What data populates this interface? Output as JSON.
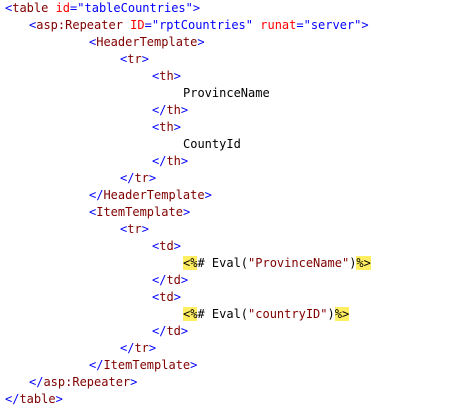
{
  "editor": {
    "colors": {
      "background": "#ffffff",
      "delimiter": "#0000ff",
      "tag_name": "#800000",
      "attribute_name": "#ff0000",
      "attribute_value": "#0000ff",
      "text": "#000000",
      "server_block_highlight": "#ffee62"
    },
    "lines": [
      {
        "open": "<",
        "tag": "table",
        "attr1": " id",
        "eq1": "=",
        "val1": "\"tableCountries\"",
        "close": ">"
      },
      {
        "open": "<",
        "tag": "asp:Repeater",
        "attr1": " ID",
        "eq1": "=",
        "val1": "\"rptCountries\"",
        "attr2": " runat",
        "eq2": "=",
        "val2": "\"server\"",
        "close": ">"
      },
      {
        "open": "<",
        "tag": "HeaderTemplate",
        "close": ">"
      },
      {
        "open": "<",
        "tag": "tr",
        "close": ">"
      },
      {
        "open": "<",
        "tag": "th",
        "close": ">"
      },
      {
        "text": "ProvinceName"
      },
      {
        "open": "</",
        "tag": "th",
        "close": ">"
      },
      {
        "open": "<",
        "tag": "th",
        "close": ">"
      },
      {
        "text": "CountyId"
      },
      {
        "open": "</",
        "tag": "th",
        "close": ">"
      },
      {
        "open": "</",
        "tag": "tr",
        "close": ">"
      },
      {
        "open": "</",
        "tag": "HeaderTemplate",
        "close": ">"
      },
      {
        "open": "<",
        "tag": "ItemTemplate",
        "close": ">"
      },
      {
        "open": "<",
        "tag": "tr",
        "close": ">"
      },
      {
        "open": "<",
        "tag": "td",
        "close": ">"
      },
      {
        "srv_open": "<%",
        "code1": "# Eval(",
        "str": "\"ProvinceName\"",
        "code2": ")",
        "srv_close": "%>"
      },
      {
        "open": "</",
        "tag": "td",
        "close": ">"
      },
      {
        "open": "<",
        "tag": "td",
        "close": ">"
      },
      {
        "srv_open": "<%",
        "code1": "# Eval(",
        "str": "\"countryID\"",
        "code2": ")",
        "srv_close": "%>"
      },
      {
        "open": "</",
        "tag": "td",
        "close": ">"
      },
      {
        "open": "</",
        "tag": "tr",
        "close": ">"
      },
      {
        "open": "</",
        "tag": "ItemTemplate",
        "close": ">"
      },
      {
        "open": "</",
        "tag": "asp:Repeater",
        "close": ">"
      },
      {
        "open": "</",
        "tag": "table",
        "close": ">"
      }
    ]
  }
}
